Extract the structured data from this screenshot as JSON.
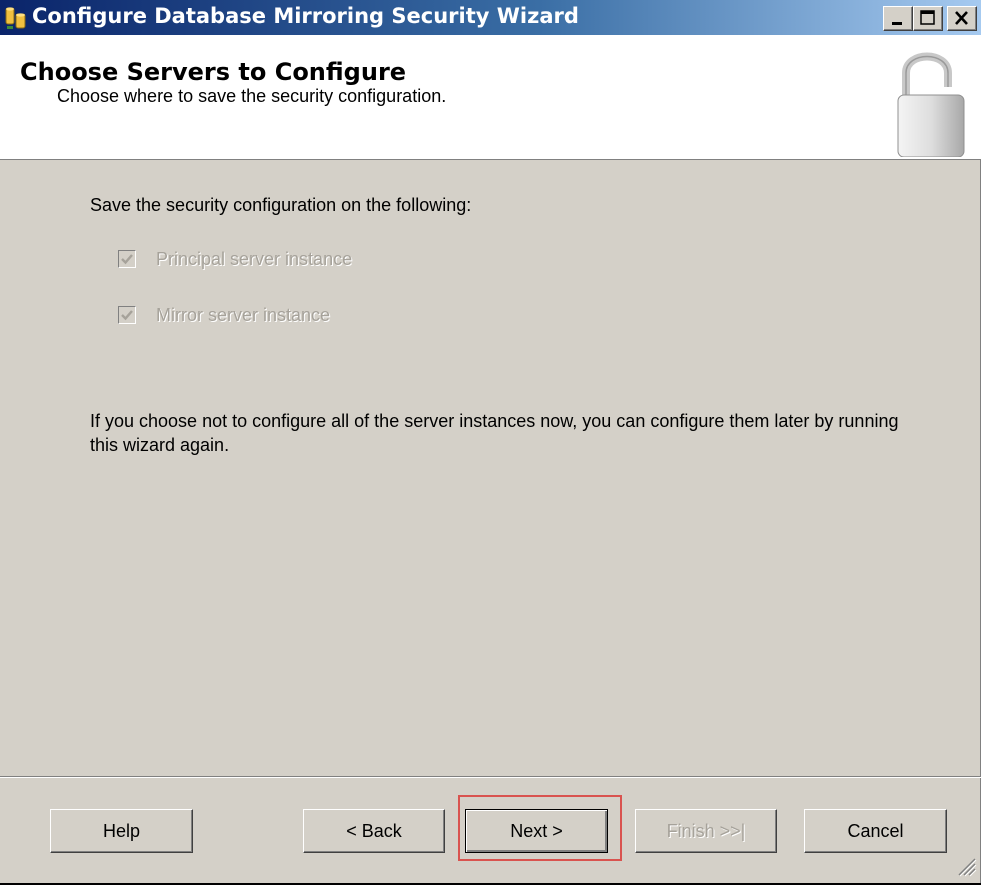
{
  "window": {
    "title": "Configure Database Mirroring Security Wizard",
    "title_icon": "database-mirroring-icon",
    "controls": [
      "minimize-icon",
      "maximize-icon",
      "close-icon"
    ]
  },
  "header": {
    "title": "Choose Servers to Configure",
    "subtitle": "Choose where to save the security configuration.",
    "icon": "padlock-icon"
  },
  "content": {
    "intro": "Save the security configuration on the following:",
    "checkboxes": [
      {
        "label": "Principal server instance",
        "checked": true,
        "enabled": false
      },
      {
        "label": "Mirror server instance",
        "checked": true,
        "enabled": false
      }
    ],
    "note": "If you choose not to configure all of the server instances now, you can configure them later by running this wizard again."
  },
  "buttons": {
    "help": "Help",
    "back": "< Back",
    "next": "Next >",
    "finish": "Finish >>|",
    "cancel": "Cancel"
  },
  "colors": {
    "titlebar_start": "#0a246a",
    "titlebar_end": "#a6caf0",
    "face": "#d4d0c8",
    "highlight_border": "#d9534f",
    "disabled_text": "#a6a29a"
  }
}
